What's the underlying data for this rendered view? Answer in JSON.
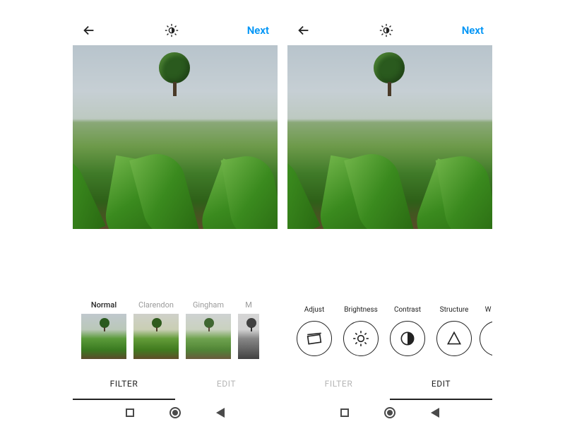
{
  "left": {
    "header": {
      "next_label": "Next"
    },
    "filters": [
      {
        "name": "Normal",
        "selected": true
      },
      {
        "name": "Clarendon",
        "selected": false
      },
      {
        "name": "Gingham",
        "selected": false
      },
      {
        "name": "M",
        "selected": false
      }
    ],
    "tabs": {
      "filter": "FILTER",
      "edit": "EDIT",
      "active": "filter"
    }
  },
  "right": {
    "header": {
      "next_label": "Next"
    },
    "tools": [
      {
        "name": "Adjust"
      },
      {
        "name": "Brightness"
      },
      {
        "name": "Contrast"
      },
      {
        "name": "Structure"
      },
      {
        "name": "W"
      }
    ],
    "tabs": {
      "filter": "FILTER",
      "edit": "EDIT",
      "active": "edit"
    }
  }
}
